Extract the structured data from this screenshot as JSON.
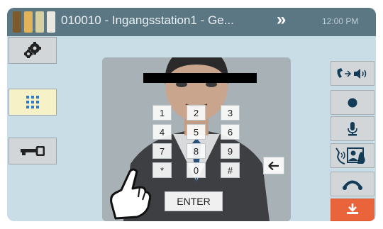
{
  "header": {
    "title": "010010 - Ingangsstation1 - Ge...",
    "time": "12:00 PM",
    "next_glyph": "»"
  },
  "keypad": {
    "keys": [
      "1",
      "2",
      "3",
      "4",
      "5",
      "6",
      "7",
      "8",
      "9",
      "*",
      "0",
      "#"
    ],
    "enter_label": "ENTER"
  },
  "colors": {
    "header_bg": "#5c7784",
    "screen_bg": "#c8dde5",
    "keypad_active_bg": "#f6f1c6",
    "end_call_bg": "#e9643a"
  },
  "icons": {
    "left": [
      "gear-icon",
      "keypad-icon",
      "key-icon"
    ],
    "right": [
      "call-transfer-icon",
      "record-icon",
      "microphone-icon",
      "privacy-mode-icon",
      "hang-up-icon",
      "end-call-icon"
    ]
  }
}
